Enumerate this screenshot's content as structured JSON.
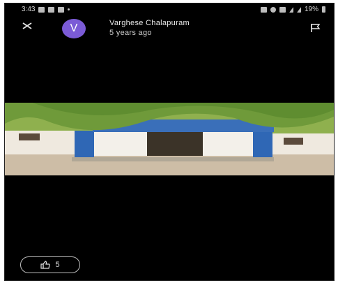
{
  "status_bar": {
    "time": "3:43",
    "battery": "19%"
  },
  "post": {
    "avatar_letter": "V",
    "author": "Varghese Chalapuram",
    "posted": "5 years ago",
    "likes": "5"
  },
  "icons": [
    "close-icon",
    "flag-icon",
    "thumbs-up-icon"
  ],
  "colors": {
    "background": "#000000",
    "avatar": "#7b5bd6",
    "text": "#e8e8e8"
  }
}
